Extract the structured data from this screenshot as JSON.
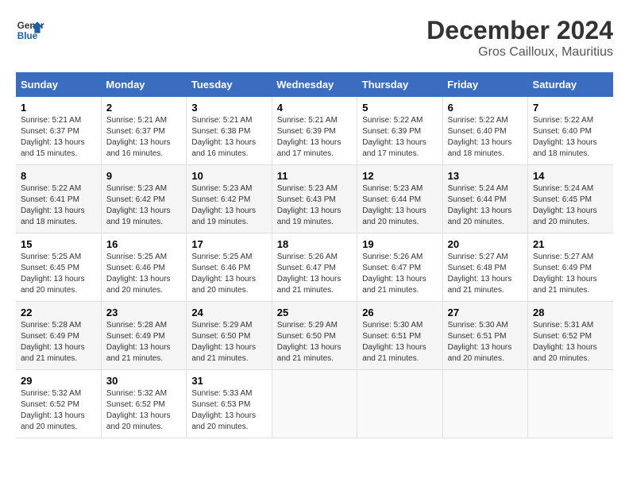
{
  "header": {
    "logo_line1": "General",
    "logo_line2": "Blue",
    "main_title": "December 2024",
    "subtitle": "Gros Cailloux, Mauritius"
  },
  "calendar": {
    "days_of_week": [
      "Sunday",
      "Monday",
      "Tuesday",
      "Wednesday",
      "Thursday",
      "Friday",
      "Saturday"
    ],
    "weeks": [
      [
        {
          "day": "1",
          "sunrise": "5:21 AM",
          "sunset": "6:37 PM",
          "daylight": "13 hours and 15 minutes."
        },
        {
          "day": "2",
          "sunrise": "5:21 AM",
          "sunset": "6:37 PM",
          "daylight": "13 hours and 16 minutes."
        },
        {
          "day": "3",
          "sunrise": "5:21 AM",
          "sunset": "6:38 PM",
          "daylight": "13 hours and 16 minutes."
        },
        {
          "day": "4",
          "sunrise": "5:21 AM",
          "sunset": "6:39 PM",
          "daylight": "13 hours and 17 minutes."
        },
        {
          "day": "5",
          "sunrise": "5:22 AM",
          "sunset": "6:39 PM",
          "daylight": "13 hours and 17 minutes."
        },
        {
          "day": "6",
          "sunrise": "5:22 AM",
          "sunset": "6:40 PM",
          "daylight": "13 hours and 18 minutes."
        },
        {
          "day": "7",
          "sunrise": "5:22 AM",
          "sunset": "6:40 PM",
          "daylight": "13 hours and 18 minutes."
        }
      ],
      [
        {
          "day": "8",
          "sunrise": "5:22 AM",
          "sunset": "6:41 PM",
          "daylight": "13 hours and 18 minutes."
        },
        {
          "day": "9",
          "sunrise": "5:23 AM",
          "sunset": "6:42 PM",
          "daylight": "13 hours and 19 minutes."
        },
        {
          "day": "10",
          "sunrise": "5:23 AM",
          "sunset": "6:42 PM",
          "daylight": "13 hours and 19 minutes."
        },
        {
          "day": "11",
          "sunrise": "5:23 AM",
          "sunset": "6:43 PM",
          "daylight": "13 hours and 19 minutes."
        },
        {
          "day": "12",
          "sunrise": "5:23 AM",
          "sunset": "6:44 PM",
          "daylight": "13 hours and 20 minutes."
        },
        {
          "day": "13",
          "sunrise": "5:24 AM",
          "sunset": "6:44 PM",
          "daylight": "13 hours and 20 minutes."
        },
        {
          "day": "14",
          "sunrise": "5:24 AM",
          "sunset": "6:45 PM",
          "daylight": "13 hours and 20 minutes."
        }
      ],
      [
        {
          "day": "15",
          "sunrise": "5:25 AM",
          "sunset": "6:45 PM",
          "daylight": "13 hours and 20 minutes."
        },
        {
          "day": "16",
          "sunrise": "5:25 AM",
          "sunset": "6:46 PM",
          "daylight": "13 hours and 20 minutes."
        },
        {
          "day": "17",
          "sunrise": "5:25 AM",
          "sunset": "6:46 PM",
          "daylight": "13 hours and 20 minutes."
        },
        {
          "day": "18",
          "sunrise": "5:26 AM",
          "sunset": "6:47 PM",
          "daylight": "13 hours and 21 minutes."
        },
        {
          "day": "19",
          "sunrise": "5:26 AM",
          "sunset": "6:47 PM",
          "daylight": "13 hours and 21 minutes."
        },
        {
          "day": "20",
          "sunrise": "5:27 AM",
          "sunset": "6:48 PM",
          "daylight": "13 hours and 21 minutes."
        },
        {
          "day": "21",
          "sunrise": "5:27 AM",
          "sunset": "6:49 PM",
          "daylight": "13 hours and 21 minutes."
        }
      ],
      [
        {
          "day": "22",
          "sunrise": "5:28 AM",
          "sunset": "6:49 PM",
          "daylight": "13 hours and 21 minutes."
        },
        {
          "day": "23",
          "sunrise": "5:28 AM",
          "sunset": "6:49 PM",
          "daylight": "13 hours and 21 minutes."
        },
        {
          "day": "24",
          "sunrise": "5:29 AM",
          "sunset": "6:50 PM",
          "daylight": "13 hours and 21 minutes."
        },
        {
          "day": "25",
          "sunrise": "5:29 AM",
          "sunset": "6:50 PM",
          "daylight": "13 hours and 21 minutes."
        },
        {
          "day": "26",
          "sunrise": "5:30 AM",
          "sunset": "6:51 PM",
          "daylight": "13 hours and 21 minutes."
        },
        {
          "day": "27",
          "sunrise": "5:30 AM",
          "sunset": "6:51 PM",
          "daylight": "13 hours and 20 minutes."
        },
        {
          "day": "28",
          "sunrise": "5:31 AM",
          "sunset": "6:52 PM",
          "daylight": "13 hours and 20 minutes."
        }
      ],
      [
        {
          "day": "29",
          "sunrise": "5:32 AM",
          "sunset": "6:52 PM",
          "daylight": "13 hours and 20 minutes."
        },
        {
          "day": "30",
          "sunrise": "5:32 AM",
          "sunset": "6:52 PM",
          "daylight": "13 hours and 20 minutes."
        },
        {
          "day": "31",
          "sunrise": "5:33 AM",
          "sunset": "6:53 PM",
          "daylight": "13 hours and 20 minutes."
        },
        null,
        null,
        null,
        null
      ]
    ]
  }
}
